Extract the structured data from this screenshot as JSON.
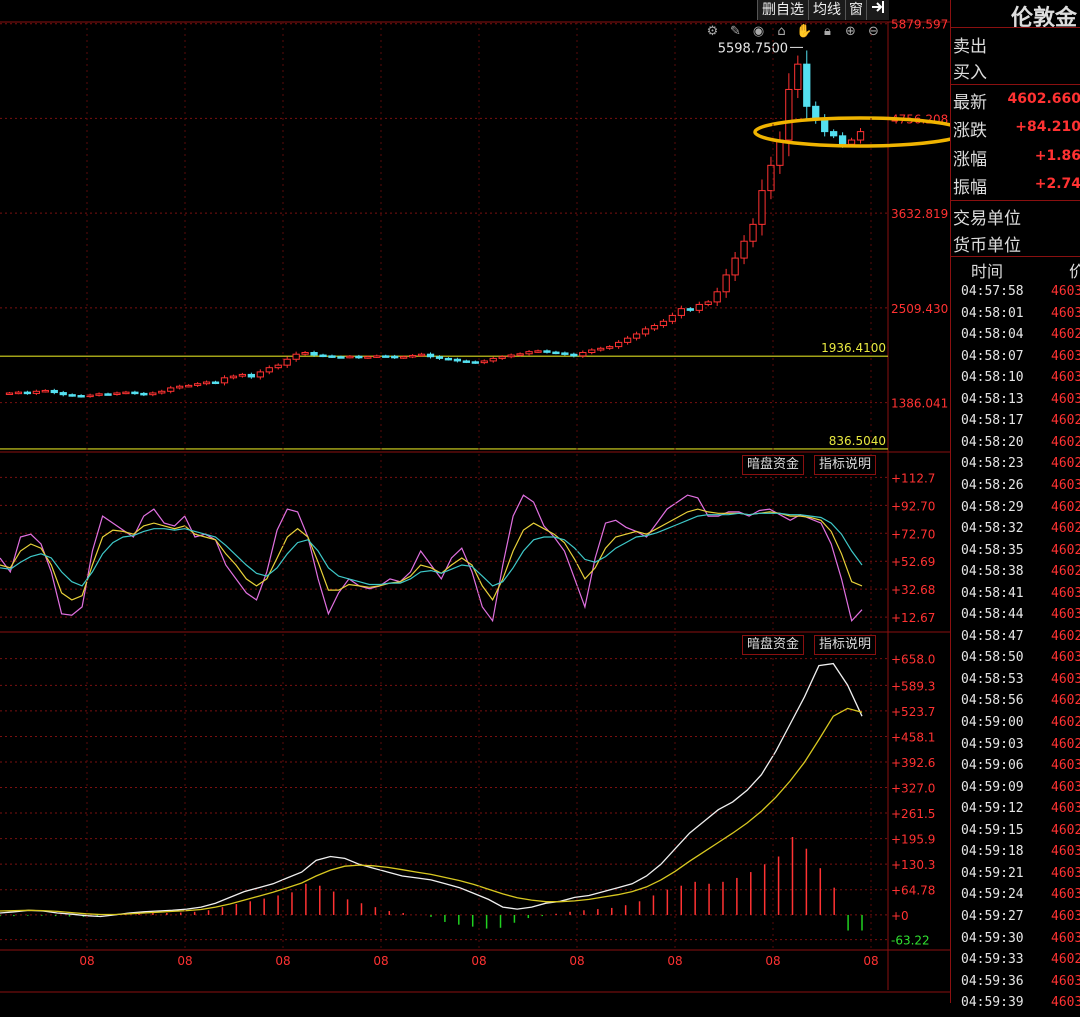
{
  "toolbar": {
    "delete_watch": "删自选",
    "ma_line": "均线",
    "window": "窗",
    "exit_icon": "exit-icon"
  },
  "chart_icons": [
    "settings-icon",
    "pen-icon",
    "eye-icon",
    "lock-open-icon",
    "hand-icon",
    "lock-icon",
    "zoom-in-icon",
    "zoom-out-icon"
  ],
  "main_chart": {
    "price_axis": [
      "5879.597",
      "4756.208",
      "3632.819",
      "2509.430",
      "1386.041"
    ],
    "peak_label": "5598.7500",
    "hlines": [
      {
        "label": "1936.4100",
        "value": 1936.41
      },
      {
        "label": "836.5040",
        "value": 836.504
      }
    ],
    "ylim": [
      800,
      5900
    ]
  },
  "indicator1": {
    "button1": "暗盘资金",
    "button2": "指标说明",
    "axis": [
      "+112.7",
      "+92.70",
      "+72.70",
      "+52.69",
      "+32.68",
      "+12.67"
    ],
    "ylim": [
      2,
      118
    ]
  },
  "indicator2": {
    "button1": "暗盘资金",
    "button2": "指标说明",
    "axis": [
      "+658.0",
      "+589.3",
      "+523.7",
      "+458.1",
      "+392.6",
      "+327.0",
      "+261.5",
      "+195.9",
      "+130.3",
      "+64.78",
      "+0",
      "-63.22"
    ],
    "ylim": [
      -90,
      680
    ]
  },
  "x_axis": {
    "labels": [
      "08",
      "08",
      "08",
      "08",
      "08",
      "08",
      "08",
      "08",
      "08"
    ]
  },
  "quote": {
    "title": "伦敦金",
    "sell_label": "卖出",
    "buy_label": "买入",
    "latest_label": "最新",
    "latest_value": "4602.660",
    "change_label": "涨跌",
    "change_value": "+84.210",
    "change_pct_label": "涨幅",
    "change_pct_value": "+1.86",
    "amplitude_label": "振幅",
    "amplitude_value": "+2.74",
    "trade_unit_label": "交易单位",
    "currency_label": "货币单位",
    "col_time": "时间",
    "col_price": "价"
  },
  "ticks": [
    {
      "time": "04:57:58",
      "price": "4603"
    },
    {
      "time": "04:58:01",
      "price": "4603"
    },
    {
      "time": "04:58:04",
      "price": "4602"
    },
    {
      "time": "04:58:07",
      "price": "4603"
    },
    {
      "time": "04:58:10",
      "price": "4603"
    },
    {
      "time": "04:58:13",
      "price": "4603"
    },
    {
      "time": "04:58:17",
      "price": "4602"
    },
    {
      "time": "04:58:20",
      "price": "4602"
    },
    {
      "time": "04:58:23",
      "price": "4602"
    },
    {
      "time": "04:58:26",
      "price": "4603"
    },
    {
      "time": "04:58:29",
      "price": "4602"
    },
    {
      "time": "04:58:32",
      "price": "4602"
    },
    {
      "time": "04:58:35",
      "price": "4602"
    },
    {
      "time": "04:58:38",
      "price": "4602"
    },
    {
      "time": "04:58:41",
      "price": "4603"
    },
    {
      "time": "04:58:44",
      "price": "4603"
    },
    {
      "time": "04:58:47",
      "price": "4602"
    },
    {
      "time": "04:58:50",
      "price": "4603"
    },
    {
      "time": "04:58:53",
      "price": "4603"
    },
    {
      "time": "04:58:56",
      "price": "4602"
    },
    {
      "time": "04:59:00",
      "price": "4602"
    },
    {
      "time": "04:59:03",
      "price": "4602"
    },
    {
      "time": "04:59:06",
      "price": "4603"
    },
    {
      "time": "04:59:09",
      "price": "4603"
    },
    {
      "time": "04:59:12",
      "price": "4603"
    },
    {
      "time": "04:59:15",
      "price": "4602"
    },
    {
      "time": "04:59:18",
      "price": "4603"
    },
    {
      "time": "04:59:21",
      "price": "4603"
    },
    {
      "time": "04:59:24",
      "price": "4603"
    },
    {
      "time": "04:59:27",
      "price": "4603"
    },
    {
      "time": "04:59:30",
      "price": "4603"
    },
    {
      "time": "04:59:33",
      "price": "4602"
    },
    {
      "time": "04:59:36",
      "price": "4603"
    },
    {
      "time": "04:59:39",
      "price": "4603"
    }
  ],
  "chart_data": {
    "type": "candlestick",
    "closes": [
      1500,
      1510,
      1495,
      1520,
      1530,
      1505,
      1480,
      1470,
      1460,
      1475,
      1490,
      1485,
      1500,
      1510,
      1495,
      1480,
      1500,
      1520,
      1560,
      1580,
      1590,
      1610,
      1630,
      1620,
      1680,
      1700,
      1720,
      1690,
      1750,
      1800,
      1830,
      1900,
      1960,
      1980,
      1950,
      1940,
      1930,
      1925,
      1935,
      1920,
      1930,
      1940,
      1935,
      1920,
      1930,
      1945,
      1960,
      1930,
      1910,
      1900,
      1880,
      1870,
      1860,
      1880,
      1910,
      1930,
      1950,
      1965,
      1990,
      2000,
      1985,
      1975,
      1960,
      1940,
      1980,
      2010,
      2030,
      2050,
      2100,
      2150,
      2200,
      2260,
      2300,
      2350,
      2420,
      2500,
      2480,
      2550,
      2580,
      2700,
      2900,
      3100,
      3300,
      3500,
      3900,
      4200,
      4500,
      5100,
      5400,
      4900,
      4750,
      4600,
      4550,
      4450,
      4500,
      4600
    ],
    "indicator1_series": [
      {
        "color": "#e070e0",
        "values": [
          55,
          45,
          70,
          72,
          65,
          45,
          15,
          14,
          20,
          60,
          85,
          80,
          75,
          70,
          85,
          90,
          80,
          78,
          85,
          70,
          72,
          68,
          50,
          40,
          30,
          25,
          45,
          75,
          90,
          88,
          70,
          40,
          15,
          30,
          40,
          35,
          33,
          35,
          40,
          38,
          45,
          60,
          50,
          40,
          55,
          62,
          45,
          20,
          10,
          50,
          85,
          100,
          95,
          78,
          70,
          60,
          40,
          20,
          55,
          80,
          82,
          77,
          74,
          70,
          80,
          90,
          95,
          100,
          98,
          85,
          85,
          88,
          88,
          85,
          89,
          90,
          86,
          82,
          86,
          83,
          80,
          65,
          40,
          10,
          18
        ]
      },
      {
        "color": "#e8d23a",
        "values": [
          50,
          48,
          60,
          65,
          62,
          50,
          30,
          25,
          28,
          50,
          70,
          75,
          74,
          72,
          78,
          80,
          78,
          76,
          78,
          72,
          70,
          68,
          58,
          50,
          40,
          35,
          40,
          55,
          70,
          76,
          70,
          52,
          32,
          32,
          36,
          35,
          34,
          35,
          37,
          38,
          42,
          50,
          48,
          44,
          50,
          55,
          50,
          35,
          25,
          40,
          60,
          75,
          80,
          76,
          72,
          66,
          54,
          40,
          48,
          62,
          70,
          72,
          74,
          72,
          76,
          80,
          84,
          88,
          90,
          88,
          87,
          87,
          87,
          86,
          87,
          88,
          87,
          85,
          85,
          84,
          82,
          74,
          58,
          38,
          35
        ]
      },
      {
        "color": "#3ec8c8",
        "values": [
          48,
          47,
          52,
          56,
          58,
          55,
          45,
          38,
          35,
          45,
          58,
          66,
          70,
          71,
          74,
          76,
          76,
          75,
          76,
          74,
          72,
          70,
          64,
          57,
          50,
          44,
          42,
          48,
          58,
          66,
          68,
          60,
          48,
          42,
          40,
          38,
          36,
          36,
          37,
          37,
          40,
          45,
          46,
          44,
          47,
          50,
          49,
          42,
          35,
          38,
          48,
          60,
          68,
          70,
          70,
          68,
          62,
          54,
          52,
          56,
          62,
          66,
          70,
          71,
          73,
          76,
          79,
          82,
          85,
          86,
          86,
          86,
          87,
          86,
          87,
          87,
          87,
          86,
          86,
          85,
          84,
          80,
          72,
          60,
          50
        ]
      }
    ],
    "indicator2_series": [
      {
        "color": "#f0f0f0",
        "values": [
          5,
          8,
          12,
          10,
          5,
          2,
          -2,
          -4,
          0,
          5,
          8,
          10,
          12,
          15,
          20,
          30,
          45,
          60,
          70,
          80,
          95,
          110,
          140,
          150,
          145,
          130,
          120,
          110,
          100,
          95,
          90,
          80,
          70,
          55,
          40,
          20,
          15,
          20,
          30,
          35,
          45,
          50,
          60,
          70,
          80,
          100,
          130,
          170,
          210,
          240,
          270,
          290,
          320,
          360,
          420,
          490,
          560,
          640,
          645,
          590,
          510
        ]
      },
      {
        "color": "#d8c820",
        "values": [
          10,
          11,
          12,
          11,
          9,
          6,
          3,
          1,
          1,
          3,
          5,
          7,
          9,
          11,
          14,
          20,
          28,
          38,
          48,
          58,
          70,
          82,
          100,
          115,
          125,
          128,
          126,
          122,
          116,
          110,
          104,
          96,
          88,
          78,
          66,
          54,
          44,
          38,
          34,
          34,
          36,
          40,
          46,
          52,
          60,
          72,
          90,
          112,
          138,
          162,
          186,
          210,
          236,
          266,
          302,
          344,
          392,
          450,
          510,
          530,
          520
        ]
      }
    ],
    "indicator2_hist": [
      -3,
      -3,
      -2,
      -2,
      -3,
      -4,
      -5,
      -5,
      -2,
      2,
      4,
      5,
      5,
      6,
      8,
      12,
      20,
      28,
      35,
      42,
      50,
      58,
      80,
      75,
      60,
      40,
      30,
      20,
      10,
      5,
      0,
      -5,
      -18,
      -25,
      -30,
      -35,
      -33,
      -20,
      -8,
      -3,
      3,
      8,
      12,
      15,
      18,
      25,
      35,
      50,
      65,
      75,
      85,
      80,
      85,
      95,
      110,
      130,
      150,
      200,
      170,
      120,
      70,
      -40,
      -40
    ]
  }
}
